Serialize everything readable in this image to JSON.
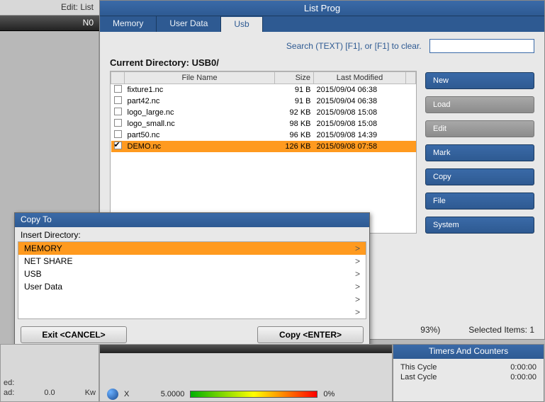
{
  "header": {
    "edit_label": "Edit: List",
    "n0_label": "N0"
  },
  "listprog": {
    "title": "List Prog",
    "tabs": [
      {
        "label": "Memory",
        "active": false
      },
      {
        "label": "User Data",
        "active": false
      },
      {
        "label": "Usb",
        "active": true
      }
    ],
    "search_hint": "Search (TEXT) [F1], or [F1] to clear.",
    "search_value": "",
    "curdir_label": "Current Directory:",
    "curdir_path": "USB0/",
    "columns": {
      "name": "File Name",
      "size": "Size",
      "modified": "Last Modified"
    },
    "rows": [
      {
        "checked": false,
        "name": "fixture1.nc",
        "size": "91 B",
        "modified": "2015/09/04 06:38",
        "selected": false
      },
      {
        "checked": false,
        "name": "part42.nc",
        "size": "91 B",
        "modified": "2015/09/04 06:38",
        "selected": false
      },
      {
        "checked": false,
        "name": "logo_large.nc",
        "size": "92 KB",
        "modified": "2015/09/08 15:08",
        "selected": false
      },
      {
        "checked": false,
        "name": "logo_small.nc",
        "size": "98 KB",
        "modified": "2015/09/08 15:08",
        "selected": false
      },
      {
        "checked": false,
        "name": "part50.nc",
        "size": "96 KB",
        "modified": "2015/09/08 14:39",
        "selected": false
      },
      {
        "checked": true,
        "name": "DEMO.nc",
        "size": "126 KB",
        "modified": "2015/09/08 07:58",
        "selected": true
      }
    ],
    "foot_pct": "93%)",
    "foot_selected": "Selected Items: 1",
    "buttons": [
      {
        "label": "New",
        "key": "<INSERT>",
        "disabled": false
      },
      {
        "label": "Load",
        "key": "<PROG>",
        "disabled": true
      },
      {
        "label": "Edit",
        "key": "<ALTER>",
        "disabled": true
      },
      {
        "label": "Mark",
        "key": "<ENTER>",
        "disabled": false
      },
      {
        "label": "Copy",
        "key": "<F2>",
        "disabled": false
      },
      {
        "label": "File",
        "key": "<F3>",
        "disabled": false
      },
      {
        "label": "System",
        "key": "<F4>",
        "disabled": false
      }
    ]
  },
  "dialog": {
    "title": "Copy To",
    "label": "Insert Directory:",
    "rows": [
      {
        "label": "MEMORY",
        "gt": ">",
        "selected": true
      },
      {
        "label": "NET SHARE",
        "gt": ">",
        "selected": false
      },
      {
        "label": "USB",
        "gt": ">",
        "selected": false
      },
      {
        "label": "User Data",
        "gt": ">",
        "selected": false
      },
      {
        "label": "",
        "gt": ">",
        "selected": false
      },
      {
        "label": "",
        "gt": ">",
        "selected": false
      }
    ],
    "exit_label": "Exit <CANCEL>",
    "copy_label": "Copy <ENTER>"
  },
  "timers": {
    "title": "Timers And Counters",
    "rows": [
      {
        "label": "This Cycle",
        "value": "0:00:00"
      },
      {
        "label": "Last Cycle",
        "value": "0:00:00"
      }
    ]
  },
  "status": {
    "ed_label": "ed:",
    "ad_label": "ad:",
    "ad_value": "0.0",
    "kw_label": "Kw",
    "x_label": "X",
    "x_value": "5.0000",
    "zero_pct": "0%"
  }
}
